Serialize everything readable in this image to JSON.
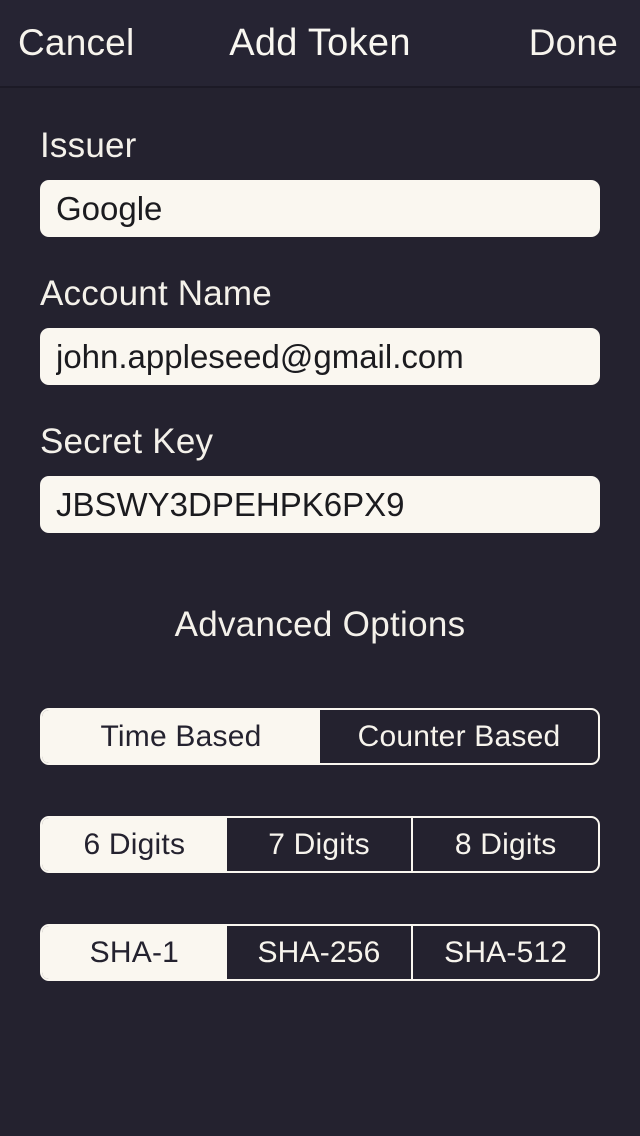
{
  "theme": {
    "background": "#24222f",
    "navbar_background": "#262433",
    "field_background": "#faf7f0",
    "text_light": "#f7f4ed",
    "text_dark": "#1b1b1f",
    "divider": "#1c1a26"
  },
  "navbar": {
    "cancel_label": "Cancel",
    "title": "Add Token",
    "done_label": "Done"
  },
  "form": {
    "issuer": {
      "label": "Issuer",
      "value": "Google",
      "placeholder": "Issuer"
    },
    "account": {
      "label": "Account Name",
      "value": "john.appleseed@gmail.com",
      "placeholder": "Account Name"
    },
    "secret": {
      "label": "Secret Key",
      "value": "JBSWY3DPEHPK6PX9",
      "placeholder": "Secret Key"
    }
  },
  "advanced": {
    "title": "Advanced Options",
    "type_control": {
      "selected_index": 0,
      "options": [
        {
          "label": "Time Based",
          "selected": true
        },
        {
          "label": "Counter Based",
          "selected": false
        }
      ]
    },
    "digits_control": {
      "selected_index": 0,
      "options": [
        {
          "label": "6 Digits",
          "selected": true
        },
        {
          "label": "7 Digits",
          "selected": false
        },
        {
          "label": "8 Digits",
          "selected": false
        }
      ]
    },
    "algorithm_control": {
      "selected_index": 0,
      "options": [
        {
          "label": "SHA-1",
          "selected": true
        },
        {
          "label": "SHA-256",
          "selected": false
        },
        {
          "label": "SHA-512",
          "selected": false
        }
      ]
    }
  }
}
